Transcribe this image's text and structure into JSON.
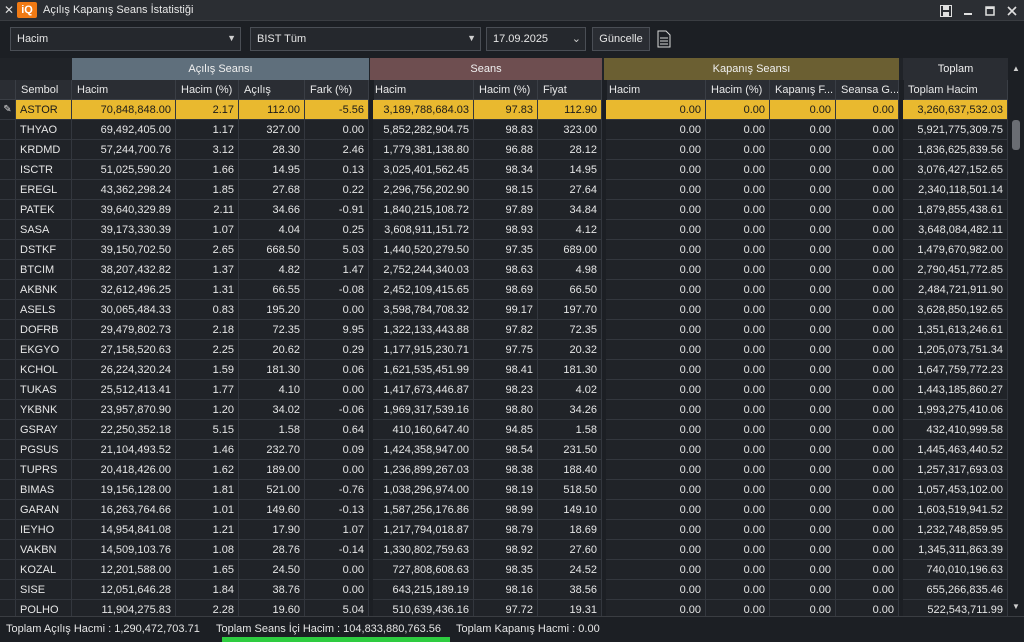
{
  "window": {
    "close_glyph": "✕",
    "logo_text": "iQ",
    "title": "Açılış Kapanış Seans İstatistiği"
  },
  "toolbar": {
    "metric_value": "Hacim",
    "market_value": "BIST Tüm",
    "date_value": "17.09.2025",
    "refresh_label": "Güncelle"
  },
  "groups": {
    "opening": "Açılış Seansı",
    "session": "Seans",
    "closing": "Kapanış Seansı",
    "total": "Toplam"
  },
  "group_colors": {
    "opening": "#5f6f7c",
    "session": "#6e4e50",
    "closing": "#6b5f32",
    "total": "#2a2d33"
  },
  "selection_color": "#e9b92f",
  "columns": [
    "Sembol",
    "Hacim",
    "Hacim (%)",
    "Açılış",
    "Fark (%)",
    "Hacim",
    "Hacim (%)",
    "Fiyat",
    "Hacim",
    "Hacim (%)",
    "Kapanış F...",
    "Seansa G...",
    "Toplam Hacim"
  ],
  "rows": [
    [
      "ASTOR",
      "70,848,848.00",
      "2.17",
      "112.00",
      "-5.56",
      "3,189,788,684.03",
      "97.83",
      "112.90",
      "0.00",
      "0.00",
      "0.00",
      "0.00",
      "3,260,637,532.03"
    ],
    [
      "THYAO",
      "69,492,405.00",
      "1.17",
      "327.00",
      "0.00",
      "5,852,282,904.75",
      "98.83",
      "323.00",
      "0.00",
      "0.00",
      "0.00",
      "0.00",
      "5,921,775,309.75"
    ],
    [
      "KRDMD",
      "57,244,700.76",
      "3.12",
      "28.30",
      "2.46",
      "1,779,381,138.80",
      "96.88",
      "28.12",
      "0.00",
      "0.00",
      "0.00",
      "0.00",
      "1,836,625,839.56"
    ],
    [
      "ISCTR",
      "51,025,590.20",
      "1.66",
      "14.95",
      "0.13",
      "3,025,401,562.45",
      "98.34",
      "14.95",
      "0.00",
      "0.00",
      "0.00",
      "0.00",
      "3,076,427,152.65"
    ],
    [
      "EREGL",
      "43,362,298.24",
      "1.85",
      "27.68",
      "0.22",
      "2,296,756,202.90",
      "98.15",
      "27.64",
      "0.00",
      "0.00",
      "0.00",
      "0.00",
      "2,340,118,501.14"
    ],
    [
      "PATEK",
      "39,640,329.89",
      "2.11",
      "34.66",
      "-0.91",
      "1,840,215,108.72",
      "97.89",
      "34.84",
      "0.00",
      "0.00",
      "0.00",
      "0.00",
      "1,879,855,438.61"
    ],
    [
      "SASA",
      "39,173,330.39",
      "1.07",
      "4.04",
      "0.25",
      "3,608,911,151.72",
      "98.93",
      "4.12",
      "0.00",
      "0.00",
      "0.00",
      "0.00",
      "3,648,084,482.11"
    ],
    [
      "DSTKF",
      "39,150,702.50",
      "2.65",
      "668.50",
      "5.03",
      "1,440,520,279.50",
      "97.35",
      "689.00",
      "0.00",
      "0.00",
      "0.00",
      "0.00",
      "1,479,670,982.00"
    ],
    [
      "BTCIM",
      "38,207,432.82",
      "1.37",
      "4.82",
      "1.47",
      "2,752,244,340.03",
      "98.63",
      "4.98",
      "0.00",
      "0.00",
      "0.00",
      "0.00",
      "2,790,451,772.85"
    ],
    [
      "AKBNK",
      "32,612,496.25",
      "1.31",
      "66.55",
      "-0.08",
      "2,452,109,415.65",
      "98.69",
      "66.50",
      "0.00",
      "0.00",
      "0.00",
      "0.00",
      "2,484,721,911.90"
    ],
    [
      "ASELS",
      "30,065,484.33",
      "0.83",
      "195.20",
      "0.00",
      "3,598,784,708.32",
      "99.17",
      "197.70",
      "0.00",
      "0.00",
      "0.00",
      "0.00",
      "3,628,850,192.65"
    ],
    [
      "DOFRB",
      "29,479,802.73",
      "2.18",
      "72.35",
      "9.95",
      "1,322,133,443.88",
      "97.82",
      "72.35",
      "0.00",
      "0.00",
      "0.00",
      "0.00",
      "1,351,613,246.61"
    ],
    [
      "EKGYO",
      "27,158,520.63",
      "2.25",
      "20.62",
      "0.29",
      "1,177,915,230.71",
      "97.75",
      "20.32",
      "0.00",
      "0.00",
      "0.00",
      "0.00",
      "1,205,073,751.34"
    ],
    [
      "KCHOL",
      "26,224,320.24",
      "1.59",
      "181.30",
      "0.06",
      "1,621,535,451.99",
      "98.41",
      "181.30",
      "0.00",
      "0.00",
      "0.00",
      "0.00",
      "1,647,759,772.23"
    ],
    [
      "TUKAS",
      "25,512,413.41",
      "1.77",
      "4.10",
      "0.00",
      "1,417,673,446.87",
      "98.23",
      "4.02",
      "0.00",
      "0.00",
      "0.00",
      "0.00",
      "1,443,185,860.27"
    ],
    [
      "YKBNK",
      "23,957,870.90",
      "1.20",
      "34.02",
      "-0.06",
      "1,969,317,539.16",
      "98.80",
      "34.26",
      "0.00",
      "0.00",
      "0.00",
      "0.00",
      "1,993,275,410.06"
    ],
    [
      "GSRAY",
      "22,250,352.18",
      "5.15",
      "1.58",
      "0.64",
      "410,160,647.40",
      "94.85",
      "1.58",
      "0.00",
      "0.00",
      "0.00",
      "0.00",
      "432,410,999.58"
    ],
    [
      "PGSUS",
      "21,104,493.52",
      "1.46",
      "232.70",
      "0.09",
      "1,424,358,947.00",
      "98.54",
      "231.50",
      "0.00",
      "0.00",
      "0.00",
      "0.00",
      "1,445,463,440.52"
    ],
    [
      "TUPRS",
      "20,418,426.00",
      "1.62",
      "189.00",
      "0.00",
      "1,236,899,267.03",
      "98.38",
      "188.40",
      "0.00",
      "0.00",
      "0.00",
      "0.00",
      "1,257,317,693.03"
    ],
    [
      "BIMAS",
      "19,156,128.00",
      "1.81",
      "521.00",
      "-0.76",
      "1,038,296,974.00",
      "98.19",
      "518.50",
      "0.00",
      "0.00",
      "0.00",
      "0.00",
      "1,057,453,102.00"
    ],
    [
      "GARAN",
      "16,263,764.66",
      "1.01",
      "149.60",
      "-0.13",
      "1,587,256,176.86",
      "98.99",
      "149.10",
      "0.00",
      "0.00",
      "0.00",
      "0.00",
      "1,603,519,941.52"
    ],
    [
      "IEYHO",
      "14,954,841.08",
      "1.21",
      "17.90",
      "1.07",
      "1,217,794,018.87",
      "98.79",
      "18.69",
      "0.00",
      "0.00",
      "0.00",
      "0.00",
      "1,232,748,859.95"
    ],
    [
      "VAKBN",
      "14,509,103.76",
      "1.08",
      "28.76",
      "-0.14",
      "1,330,802,759.63",
      "98.92",
      "27.60",
      "0.00",
      "0.00",
      "0.00",
      "0.00",
      "1,345,311,863.39"
    ],
    [
      "KOZAL",
      "12,201,588.00",
      "1.65",
      "24.50",
      "0.00",
      "727,808,608.63",
      "98.35",
      "24.52",
      "0.00",
      "0.00",
      "0.00",
      "0.00",
      "740,010,196.63"
    ],
    [
      "SISE",
      "12,051,646.28",
      "1.84",
      "38.76",
      "0.00",
      "643,215,189.19",
      "98.16",
      "38.56",
      "0.00",
      "0.00",
      "0.00",
      "0.00",
      "655,266,835.46"
    ],
    [
      "POLHO",
      "11,904,275.83",
      "2.28",
      "19.60",
      "5.04",
      "510,639,436.16",
      "97.72",
      "19.31",
      "0.00",
      "0.00",
      "0.00",
      "0.00",
      "522,543,711.99"
    ]
  ],
  "selected_row_indicator": "✎",
  "status": {
    "opening_total": "Toplam Açılış Hacmi : 1,290,472,703.71",
    "session_total": "Toplam Seans İçi Hacim : 104,833,880,763.56",
    "closing_total": "Toplam Kapanış Hacmi : 0.00"
  }
}
